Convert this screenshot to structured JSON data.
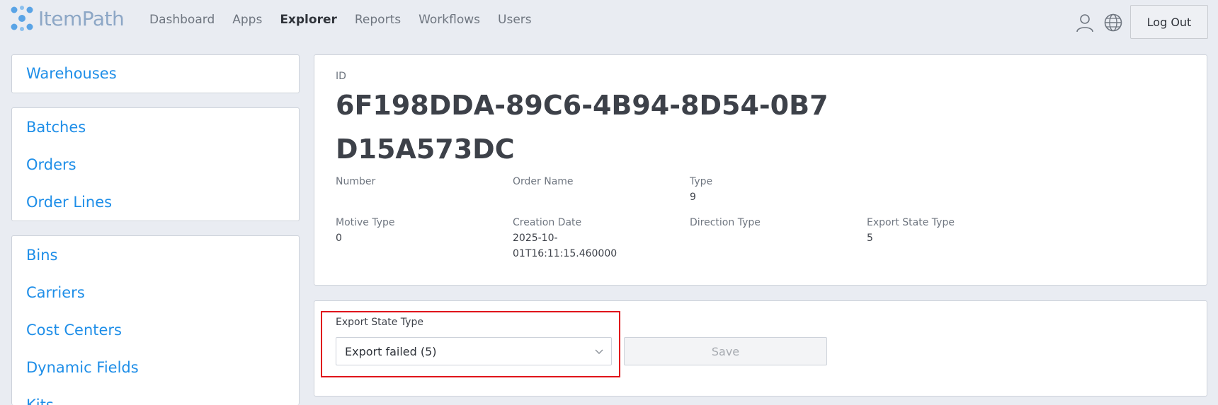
{
  "header": {
    "logo_text": "ItemPath",
    "nav": [
      "Dashboard",
      "Apps",
      "Explorer",
      "Reports",
      "Workflows",
      "Users"
    ],
    "active_nav": "Explorer",
    "logout_label": "Log Out"
  },
  "sidebar": {
    "group1": [
      "Warehouses"
    ],
    "group2": [
      "Batches",
      "Orders",
      "Order Lines"
    ],
    "group3": [
      "Bins",
      "Carriers",
      "Cost Centers",
      "Dynamic Fields",
      "Kits"
    ]
  },
  "detail": {
    "id_label": "ID",
    "id_value": "6F198DDA-89C6-4B94-8D54-0B7D15A573DC",
    "number_label": "Number",
    "number_value": "",
    "order_name_label": "Order Name",
    "order_name_value": "",
    "type_label": "Type",
    "type_value": "9",
    "motive_type_label": "Motive Type",
    "motive_type_value": "0",
    "creation_date_label": "Creation Date",
    "creation_date_value_line1": "2025-10-",
    "creation_date_value_line2": "01T16:11:15.460000",
    "direction_type_label": "Direction Type",
    "direction_type_value": "",
    "export_state_type_label": "Export State Type",
    "export_state_type_value": "5"
  },
  "export_form": {
    "label": "Export State Type",
    "selected": "Export failed (5)",
    "save_label": "Save"
  },
  "colors": {
    "link": "#1e8ee8",
    "highlight": "#e0141b",
    "background": "#e9ecf2"
  }
}
